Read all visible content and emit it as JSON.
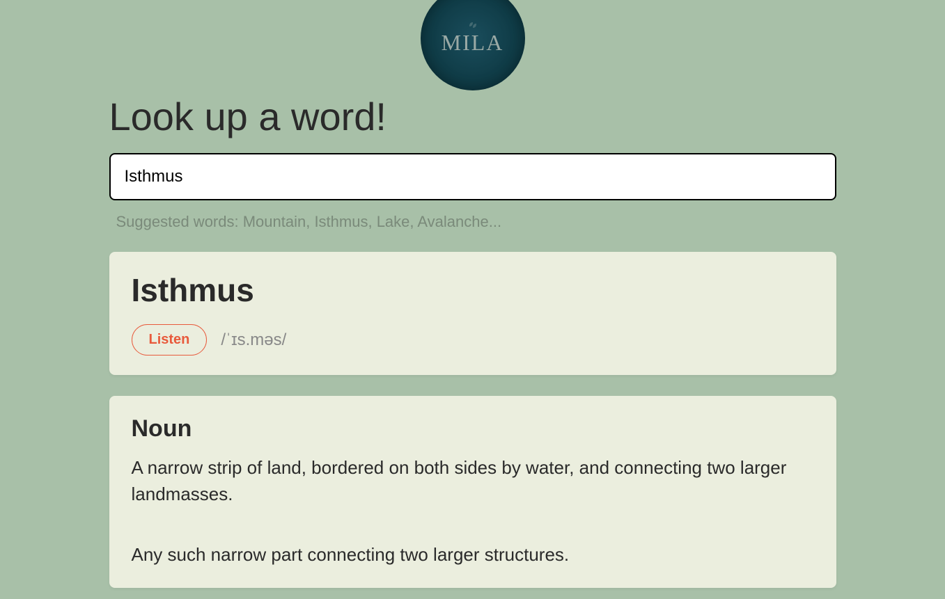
{
  "logo": {
    "text": "MILA"
  },
  "header": {
    "title": "Look up a word!"
  },
  "search": {
    "value": "Isthmus",
    "suggestions": "Suggested words: Mountain, Isthmus, Lake, Avalanche..."
  },
  "result": {
    "word": "Isthmus",
    "listen_label": "Listen",
    "phonetic": "/ˈɪs.məs/"
  },
  "definition_block": {
    "part_of_speech": "Noun",
    "definitions": [
      "A narrow strip of land, bordered on both sides by water, and connecting two larger landmasses.",
      "Any such narrow part connecting two larger structures."
    ]
  }
}
